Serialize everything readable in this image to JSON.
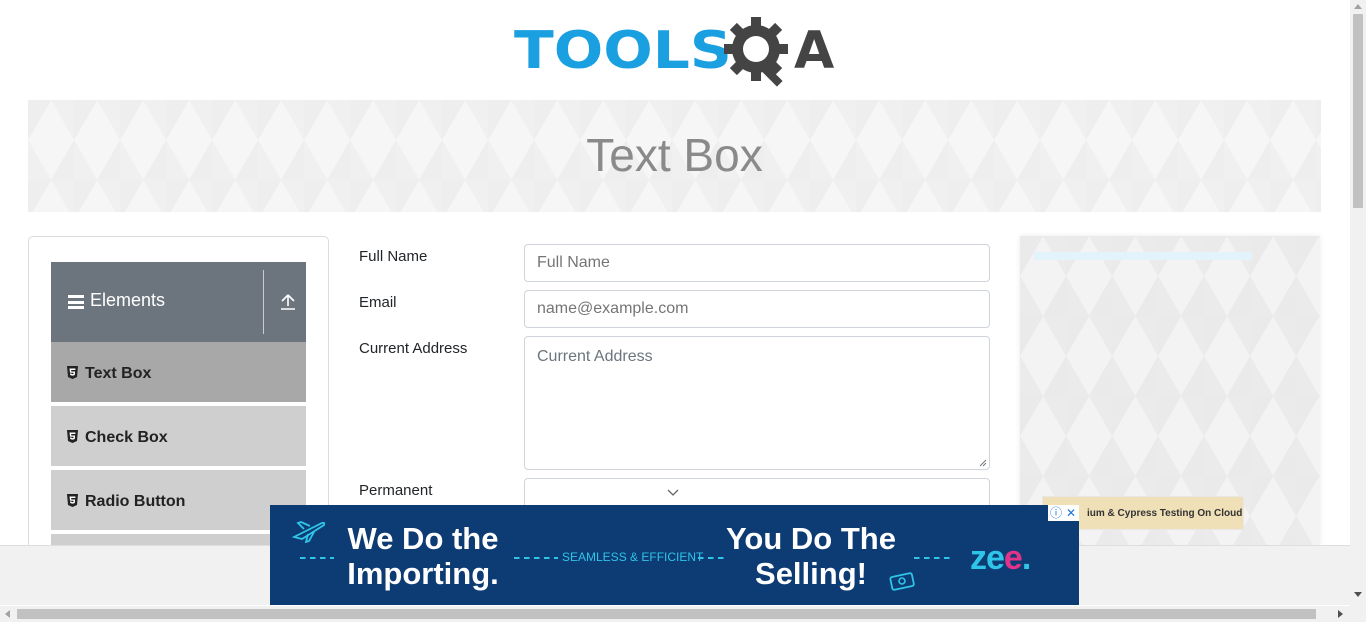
{
  "logo": {
    "text": "TOOLS",
    "suffix": "A",
    "colors": {
      "primary": "#1aa0e0",
      "secondary": "#444444"
    },
    "icon": "gear-magnifier-icon"
  },
  "banner": {
    "title": "Text Box"
  },
  "sidebar": {
    "group": {
      "title": "Elements",
      "menu_icon": "hamburger-icon",
      "collapse_icon": "upload-arrow-icon"
    },
    "items": [
      {
        "label": "Text Box",
        "icon": "html5-icon",
        "active": true
      },
      {
        "label": "Check Box",
        "icon": "html5-icon",
        "active": false
      },
      {
        "label": "Radio Button",
        "icon": "html5-icon",
        "active": false
      }
    ]
  },
  "form": {
    "full_name": {
      "label": "Full Name",
      "placeholder": "Full Name",
      "value": ""
    },
    "email": {
      "label": "Email",
      "placeholder": "name@example.com",
      "value": ""
    },
    "current_address": {
      "label": "Current Address",
      "placeholder": "Current Address",
      "value": ""
    },
    "permanent_address": {
      "label": "Permanent"
    }
  },
  "side_ad": {
    "promo_text": "ium & Cypress Testing On Cloud"
  },
  "ad": {
    "headline_1": "We Do the Importing.",
    "tagline": "SEAMLESS & EFFICIENT",
    "headline_2": "You Do The Selling!",
    "brand": {
      "z": "z",
      "e1": "e",
      "e2": "e",
      "dot": "."
    },
    "colors": {
      "background": "#0d3b73",
      "accent": "#2ec5e8",
      "brand_pink": "#e0338a"
    },
    "info_icon": "ⓘ",
    "close_icon": "✕"
  }
}
